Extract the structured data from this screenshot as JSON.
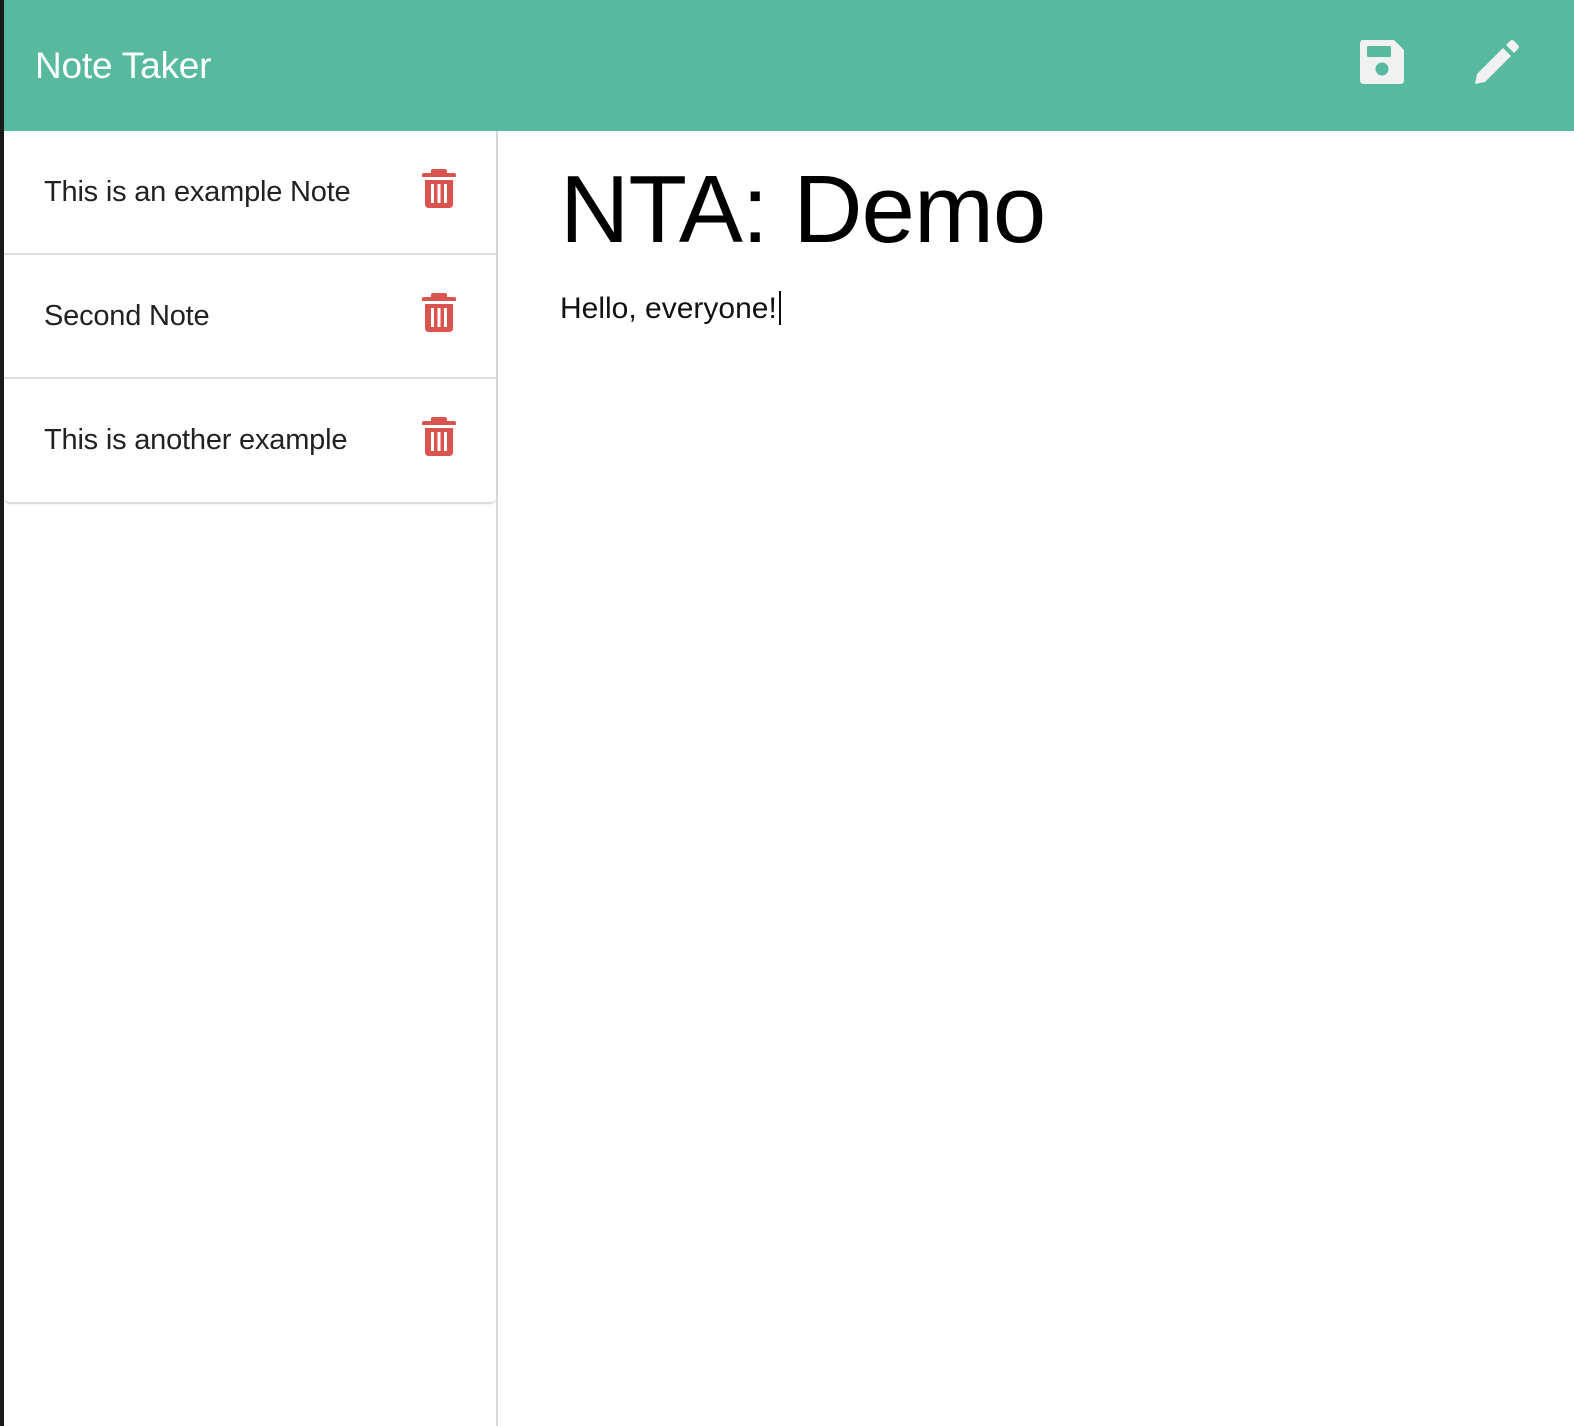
{
  "navbar": {
    "brand": "Note Taker",
    "save_icon": "floppy-disk-icon",
    "write_icon": "pencil-icon",
    "bg_color": "#57b99d"
  },
  "sidebar": {
    "notes": [
      {
        "title": "This is an example Note",
        "delete_icon": "trash-icon"
      },
      {
        "title": "Second Note",
        "delete_icon": "trash-icon"
      },
      {
        "title": "This is another example",
        "delete_icon": "trash-icon"
      }
    ],
    "delete_color": "#d9534f"
  },
  "editor": {
    "title": "NTA: Demo",
    "body": "Hello, everyone!"
  }
}
